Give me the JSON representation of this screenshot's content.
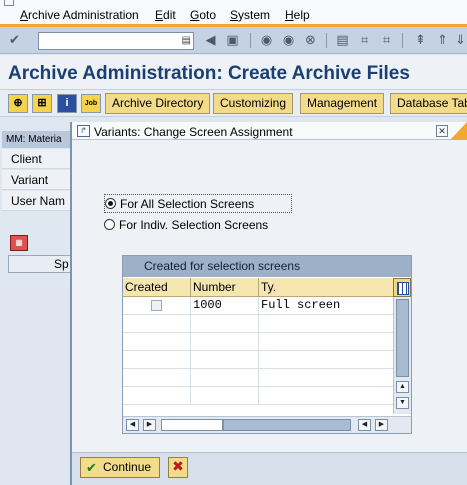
{
  "menubar": {
    "items": [
      {
        "label": "Archive Administration",
        "u": "A"
      },
      {
        "label": "Edit",
        "u": "E"
      },
      {
        "label": "Goto",
        "u": "G"
      },
      {
        "label": "System",
        "u": "S"
      },
      {
        "label": "Help",
        "u": "H"
      }
    ]
  },
  "toolbar": {
    "command_value": ""
  },
  "page": {
    "title": "Archive Administration: Create Archive Files"
  },
  "apptoolbar": {
    "job_icon_text": "Job",
    "buttons": [
      "Archive Directory",
      "Customizing",
      "Management",
      "Database Tab"
    ]
  },
  "background": {
    "header": "MM: Materia",
    "labels": [
      "Client",
      "Variant",
      "User Nam"
    ],
    "row2_text": "Sp"
  },
  "dialog": {
    "title": "Variants: Change Screen Assignment",
    "radio_all": "For All Selection Screens",
    "radio_indiv": "For Indiv. Selection Screens",
    "radio_selected": "all",
    "table": {
      "title": "Created for selection screens",
      "columns": [
        "Created",
        "Number",
        "Ty."
      ],
      "rows": [
        {
          "created": false,
          "number": "1000",
          "type": "Full screen"
        }
      ]
    },
    "continue_label": "Continue"
  }
}
